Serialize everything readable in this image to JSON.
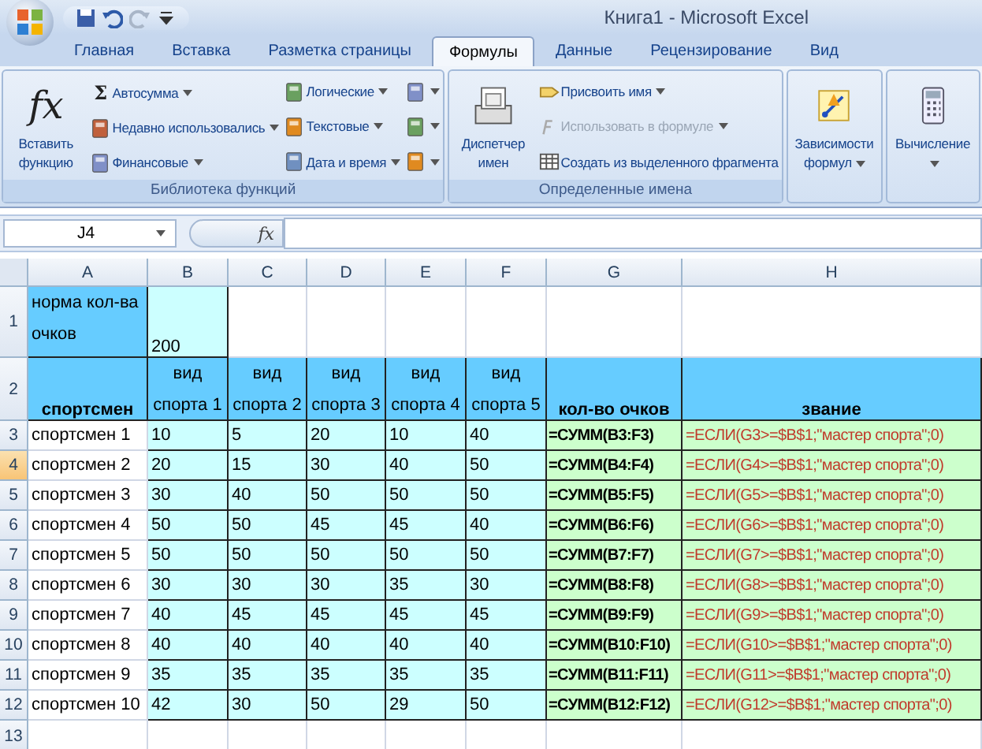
{
  "window": {
    "title": "Книга1 - Microsoft Excel"
  },
  "tabs": [
    {
      "label": "Главная",
      "selected": false
    },
    {
      "label": "Вставка",
      "selected": false
    },
    {
      "label": "Разметка страницы",
      "selected": false
    },
    {
      "label": "Формулы",
      "selected": true
    },
    {
      "label": "Данные",
      "selected": false
    },
    {
      "label": "Рецензирование",
      "selected": false
    },
    {
      "label": "Вид",
      "selected": false
    }
  ],
  "ribbon": {
    "groups": [
      {
        "label": "Библиотека функций",
        "items": [
          {
            "kind": "large",
            "label": "Вставить функцию",
            "glyph": "fx",
            "dropdown": false,
            "disabled": false
          },
          {
            "kind": "small",
            "label": "Автосумма",
            "glyph": "Σ",
            "dropdown": true,
            "disabled": false
          },
          {
            "kind": "small",
            "label": "Недавно использовались",
            "dropdown": true,
            "disabled": false
          },
          {
            "kind": "small",
            "label": "Финансовые",
            "dropdown": true,
            "disabled": false
          },
          {
            "kind": "small",
            "label": "Логические",
            "dropdown": true,
            "disabled": false
          },
          {
            "kind": "small",
            "label": "Текстовые",
            "dropdown": true,
            "disabled": false
          },
          {
            "kind": "small",
            "label": "Дата и время",
            "dropdown": true,
            "disabled": false
          },
          {
            "kind": "icon",
            "dropdown": true,
            "disabled": false
          },
          {
            "kind": "icon",
            "dropdown": true,
            "disabled": false
          },
          {
            "kind": "icon",
            "dropdown": true,
            "disabled": false
          }
        ]
      },
      {
        "label": "Определенные имена",
        "items": [
          {
            "kind": "large",
            "label": "Диспетчер имен",
            "dropdown": false,
            "disabled": false
          },
          {
            "kind": "small",
            "label": "Присвоить имя",
            "dropdown": true,
            "disabled": false
          },
          {
            "kind": "small",
            "label": "Использовать в формуле",
            "dropdown": true,
            "disabled": true
          },
          {
            "kind": "small",
            "label": "Создать из выделенного фрагмента",
            "dropdown": false,
            "disabled": false
          }
        ]
      },
      {
        "items": [
          {
            "kind": "large",
            "label": "Зависимости формул",
            "dropdown": true,
            "disabled": false
          }
        ]
      },
      {
        "items": [
          {
            "kind": "large",
            "label": "Вычисление",
            "dropdown": true,
            "disabled": false
          }
        ]
      }
    ]
  },
  "formula_bar": {
    "name_box": "J4",
    "fx_glyph": "fx"
  },
  "sheet": {
    "columns": [
      {
        "label": "A",
        "selected": false
      },
      {
        "label": "B",
        "selected": false
      },
      {
        "label": "C",
        "selected": false
      },
      {
        "label": "D",
        "selected": false
      },
      {
        "label": "E",
        "selected": false
      },
      {
        "label": "F",
        "selected": false
      },
      {
        "label": "G",
        "selected": false
      },
      {
        "label": "H",
        "selected": false
      }
    ],
    "rows": [
      {
        "number": "1",
        "kind": "title",
        "selected": false,
        "cells": [
          "норма кол-ва очков",
          "200"
        ]
      },
      {
        "number": "2",
        "kind": "header",
        "selected": false,
        "cells": [
          "спортсмен",
          "вид спорта 1",
          "вид спорта 2",
          "вид спорта 3",
          "вид спорта 4",
          "вид спорта 5",
          "кол-во очков",
          "звание"
        ]
      },
      {
        "number": "3",
        "kind": "data",
        "selected": false,
        "cells": [
          "спортсмен 1",
          "10",
          "5",
          "20",
          "10",
          "40",
          "=СУММ(B3:F3)",
          "=ЕСЛИ(G3>=$B$1;\"мастер спорта\";0)"
        ]
      },
      {
        "number": "4",
        "kind": "data",
        "selected": true,
        "cells": [
          "спортсмен 2",
          "20",
          "15",
          "30",
          "40",
          "50",
          "=СУММ(B4:F4)",
          "=ЕСЛИ(G4>=$B$1;\"мастер спорта\";0)"
        ]
      },
      {
        "number": "5",
        "kind": "data",
        "selected": false,
        "cells": [
          "спортсмен 3",
          "30",
          "40",
          "50",
          "50",
          "50",
          "=СУММ(B5:F5)",
          "=ЕСЛИ(G5>=$B$1;\"мастер спорта\";0)"
        ]
      },
      {
        "number": "6",
        "kind": "data",
        "selected": false,
        "cells": [
          "спортсмен 4",
          "50",
          "50",
          "45",
          "45",
          "40",
          "=СУММ(B6:F6)",
          "=ЕСЛИ(G6>=$B$1;\"мастер спорта\";0)"
        ]
      },
      {
        "number": "7",
        "kind": "data",
        "selected": false,
        "cells": [
          "спортсмен 5",
          "50",
          "50",
          "50",
          "50",
          "50",
          "=СУММ(B7:F7)",
          "=ЕСЛИ(G7>=$B$1;\"мастер спорта\";0)"
        ]
      },
      {
        "number": "8",
        "kind": "data",
        "selected": false,
        "cells": [
          "спортсмен 6",
          "30",
          "30",
          "30",
          "35",
          "30",
          "=СУММ(B8:F8)",
          "=ЕСЛИ(G8>=$B$1;\"мастер спорта\";0)"
        ]
      },
      {
        "number": "9",
        "kind": "data",
        "selected": false,
        "cells": [
          "спортсмен 7",
          "40",
          "45",
          "45",
          "45",
          "45",
          "=СУММ(B9:F9)",
          "=ЕСЛИ(G9>=$B$1;\"мастер спорта\";0)"
        ]
      },
      {
        "number": "10",
        "kind": "data",
        "selected": false,
        "cells": [
          "спортсмен 8",
          "40",
          "40",
          "40",
          "40",
          "40",
          "=СУММ(B10:F10)",
          "=ЕСЛИ(G10>=$B$1;\"мастер спорта\";0)"
        ]
      },
      {
        "number": "11",
        "kind": "data",
        "selected": false,
        "cells": [
          "спортсмен 9",
          "35",
          "35",
          "35",
          "35",
          "35",
          "=СУММ(B11:F11)",
          "=ЕСЛИ(G11>=$B$1;\"мастер спорта\";0)"
        ]
      },
      {
        "number": "12",
        "kind": "data",
        "selected": false,
        "cells": [
          "спортсмен 10",
          "42",
          "30",
          "50",
          "29",
          "50",
          "=СУММ(B12:F12)",
          "=ЕСЛИ(G12>=$B$1;\"мастер спорта\";0)"
        ]
      },
      {
        "number": "13",
        "kind": "blank",
        "selected": false
      }
    ]
  }
}
